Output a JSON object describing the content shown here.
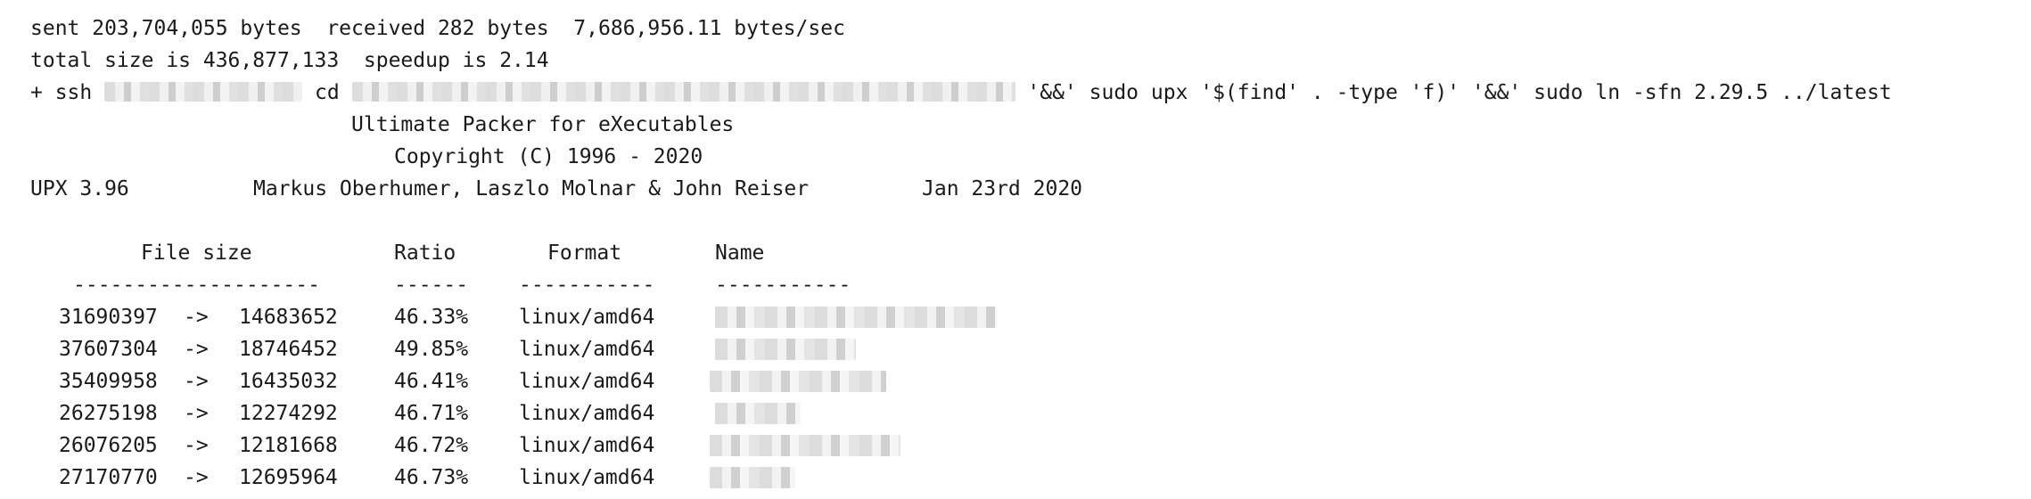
{
  "lines": {
    "sent": "sent 203,704,055 bytes  received 282 bytes  7,686,956.11 bytes/sec",
    "total": "total size is 436,877,133  speedup is 2.14",
    "ssh_prefix": "+ ssh",
    "ssh_cd": "cd",
    "ssh_suffix": "'&&' sudo upx '$(find' . -type 'f)' '&&' sudo ln -sfn 2.29.5 ../latest",
    "upx_title": "Ultimate Packer for eXecutables",
    "upx_copyright": "Copyright (C) 1996 - 2020",
    "upx_version": "UPX 3.96",
    "upx_authors": "Markus Oberhumer, Laszlo Molnar & John Reiser",
    "upx_date": "Jan 23rd 2020"
  },
  "table": {
    "headers": {
      "file_size": "File size",
      "ratio": "Ratio",
      "format": "Format",
      "name": "Name"
    },
    "separators": {
      "file_size": "--------------------",
      "ratio": "------",
      "format": "-----------",
      "name": "-----------"
    },
    "rows": [
      {
        "from": "31690397",
        "arrow": "->",
        "to": "14683652",
        "ratio": "46.33%",
        "format": "linux/amd64"
      },
      {
        "from": "37607304",
        "arrow": "->",
        "to": "18746452",
        "ratio": "49.85%",
        "format": "linux/amd64"
      },
      {
        "from": "35409958",
        "arrow": "->",
        "to": "16435032",
        "ratio": "46.41%",
        "format": "linux/amd64"
      },
      {
        "from": "26275198",
        "arrow": "->",
        "to": "12274292",
        "ratio": "46.71%",
        "format": "linux/amd64"
      },
      {
        "from": "26076205",
        "arrow": "->",
        "to": "12181668",
        "ratio": "46.72%",
        "format": "linux/amd64"
      },
      {
        "from": "27170770",
        "arrow": "->",
        "to": "12695964",
        "ratio": "46.73%",
        "format": "linux/amd64"
      }
    ]
  }
}
